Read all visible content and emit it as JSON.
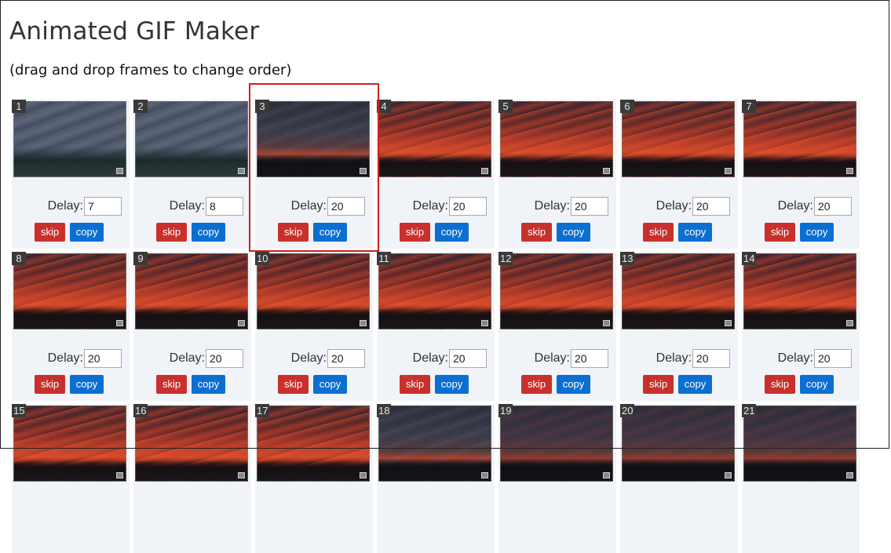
{
  "header": {
    "title": "Animated GIF Maker",
    "subtitle": "(drag and drop frames to change order)"
  },
  "labels": {
    "delay": "Delay:",
    "skip": "skip",
    "copy": "copy"
  },
  "frames": [
    {
      "number": "1",
      "delay": "7",
      "thumb": "gray"
    },
    {
      "number": "2",
      "delay": "8",
      "thumb": "gray"
    },
    {
      "number": "3",
      "delay": "20",
      "thumb": "dusk"
    },
    {
      "number": "4",
      "delay": "20",
      "thumb": "fire"
    },
    {
      "number": "5",
      "delay": "20",
      "thumb": "fire"
    },
    {
      "number": "6",
      "delay": "20",
      "thumb": "fire"
    },
    {
      "number": "7",
      "delay": "20",
      "thumb": "fire"
    },
    {
      "number": "8",
      "delay": "20",
      "thumb": "fire"
    },
    {
      "number": "9",
      "delay": "20",
      "thumb": "fire"
    },
    {
      "number": "10",
      "delay": "20",
      "thumb": "fire"
    },
    {
      "number": "11",
      "delay": "20",
      "thumb": "fire"
    },
    {
      "number": "12",
      "delay": "20",
      "thumb": "fire"
    },
    {
      "number": "13",
      "delay": "20",
      "thumb": "fire"
    },
    {
      "number": "14",
      "delay": "20",
      "thumb": "fire"
    },
    {
      "number": "15",
      "delay": null,
      "thumb": "fire"
    },
    {
      "number": "16",
      "delay": null,
      "thumb": "fire"
    },
    {
      "number": "17",
      "delay": null,
      "thumb": "fire"
    },
    {
      "number": "18",
      "delay": null,
      "thumb": "dusk"
    },
    {
      "number": "19",
      "delay": null,
      "thumb": "dark"
    },
    {
      "number": "20",
      "delay": null,
      "thumb": "dark"
    },
    {
      "number": "21",
      "delay": null,
      "thumb": "dark"
    }
  ],
  "selected_frame": "3",
  "colors": {
    "skip_button": "#c9302c",
    "copy_button": "#0b6fd1",
    "selection_outline": "#d02020",
    "cell_background": "#f0f3f7"
  }
}
